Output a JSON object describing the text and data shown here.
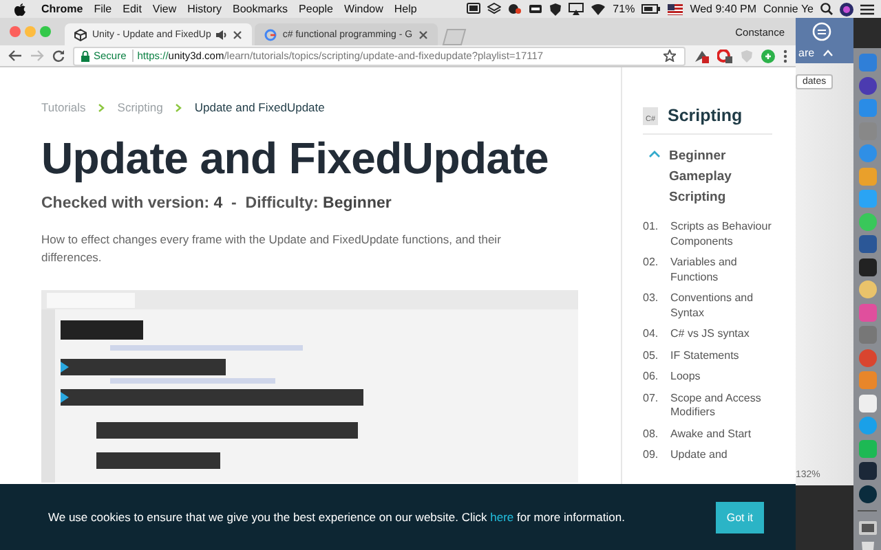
{
  "menu_bar": {
    "app": "Chrome",
    "items": [
      "File",
      "Edit",
      "View",
      "History",
      "Bookmarks",
      "People",
      "Window",
      "Help"
    ],
    "battery": "71%",
    "clock": "Wed 9:40 PM",
    "user": "Connie Ye"
  },
  "browser": {
    "tabs": [
      {
        "title": "Unity - Update and FixedUp",
        "selected": true,
        "audio": true
      },
      {
        "title": "c# functional programming - G",
        "selected": false,
        "audio": false
      }
    ],
    "profile": "Constance",
    "address": {
      "secure_label": "Secure",
      "scheme": "https://",
      "host": "unity3d.com",
      "path": "/learn/tutorials/topics/scripting/update-and-fixedupdate?playlist=17117"
    }
  },
  "page": {
    "breadcrumbs": [
      {
        "label": "Tutorials",
        "current": false
      },
      {
        "label": "Scripting",
        "current": false
      },
      {
        "label": "Update and FixedUpdate",
        "current": true
      }
    ],
    "title": "Update and FixedUpdate",
    "meta": "Checked with version: **4**  -  Difficulty: **Beginner**",
    "description": "How to effect changes every frame with the Update and FixedUpdate functions, and their differences."
  },
  "sidebar": {
    "icon_label": "C#",
    "title": "Scripting",
    "section": {
      "title": "Beginner Gameplay Scripting",
      "expanded": true
    },
    "lessons": [
      {
        "number": "01.",
        "title": "Scripts as Behaviour Components"
      },
      {
        "number": "02.",
        "title": "Variables and Functions"
      },
      {
        "number": "03.",
        "title": "Conventions and Syntax"
      },
      {
        "number": "04.",
        "title": "C# vs JS syntax"
      },
      {
        "number": "05.",
        "title": "IF Statements"
      },
      {
        "number": "06.",
        "title": "Loops"
      },
      {
        "number": "07.",
        "title": "Scope and Access Modifiers"
      },
      {
        "number": "08.",
        "title": "Awake and Start"
      },
      {
        "number": "09.",
        "title": "Update and"
      }
    ]
  },
  "cookie_banner": {
    "before": "We use cookies to ensure that we give you the best experience on our website. Click ",
    "link": "here",
    "after": " for more information.",
    "button": "Got it"
  },
  "background_window": {
    "ribbon_text": "are",
    "button": "dates",
    "zoom": "132%"
  }
}
